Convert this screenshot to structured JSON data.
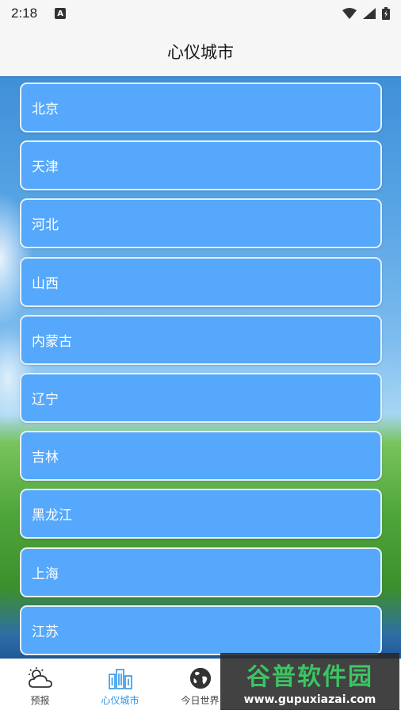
{
  "status_bar": {
    "time": "2:18",
    "notification_letter": "A"
  },
  "app_bar": {
    "title": "心仪城市"
  },
  "provinces": [
    "北京",
    "天津",
    "河北",
    "山西",
    "内蒙古",
    "辽宁",
    "吉林",
    "黑龙江",
    "上海",
    "江苏"
  ],
  "bottom_nav": {
    "items": [
      {
        "label": "预报",
        "icon": "weather-cloud-icon"
      },
      {
        "label": "心仪城市",
        "icon": "city-buildings-icon"
      },
      {
        "label": "今日世界",
        "icon": "globe-icon"
      }
    ],
    "active_index": 1
  },
  "watermark": {
    "name": "谷普软件园",
    "url": "www.gupuxiazai.com"
  },
  "colors": {
    "item_bg": "#55a8fb",
    "active_nav": "#2f96e8"
  }
}
